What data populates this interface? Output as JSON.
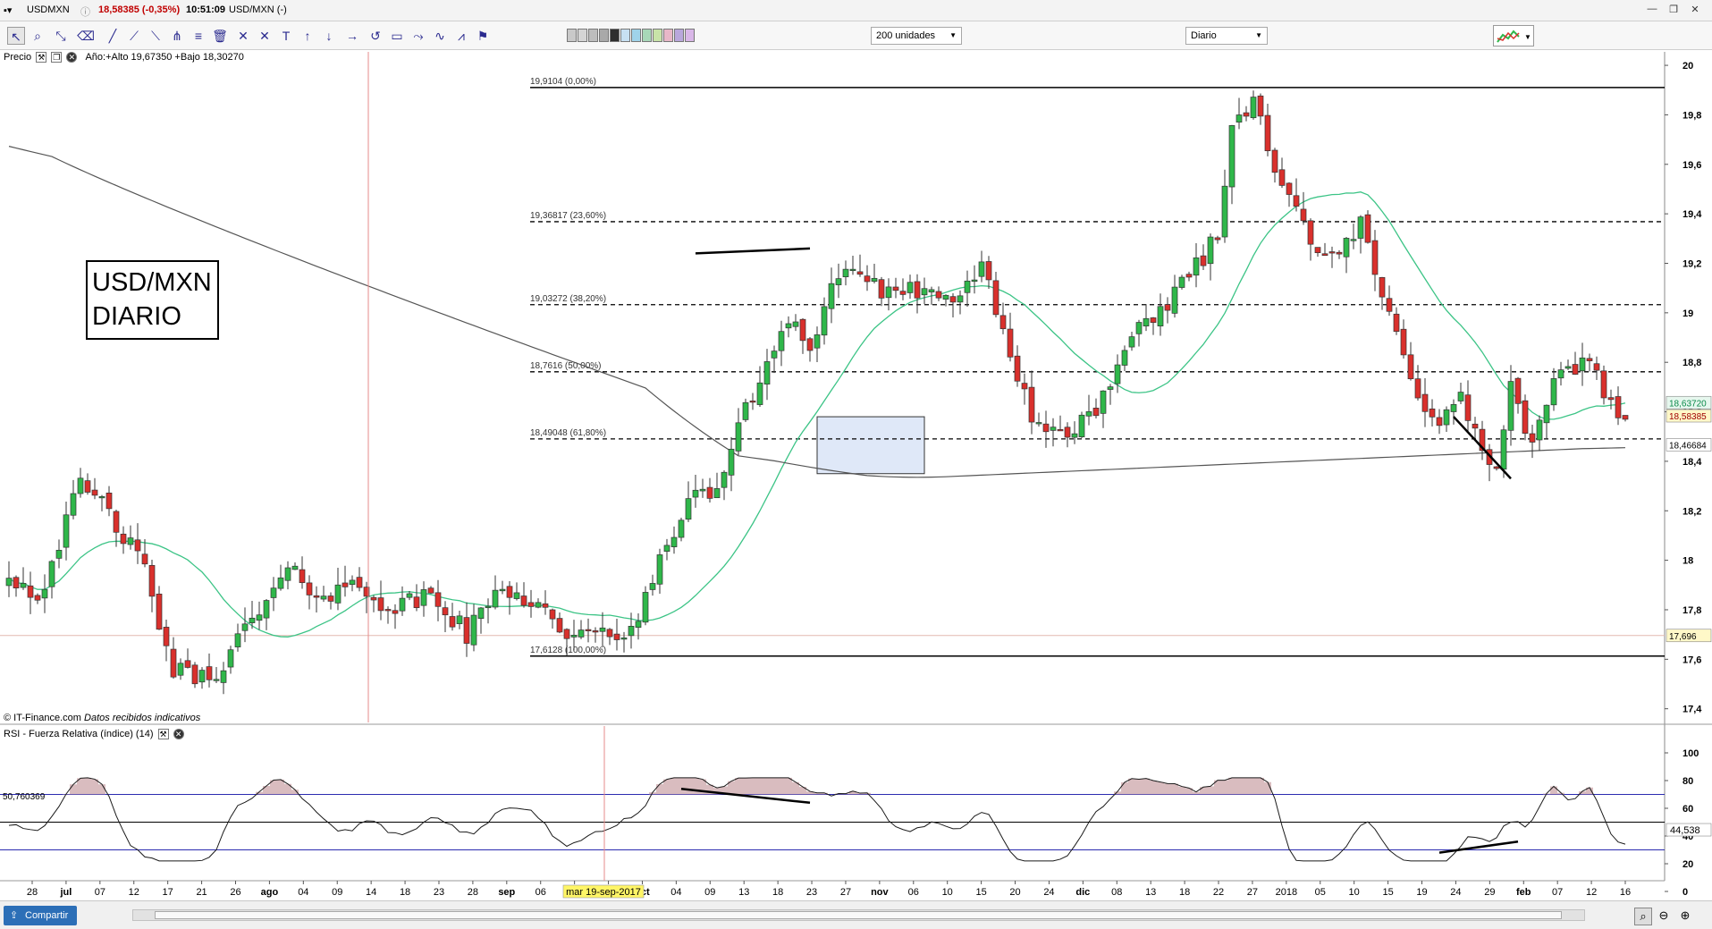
{
  "window": {
    "symbol": "USDMXN",
    "price": "18,58385 (-0,35%)",
    "time": "10:51:09",
    "title": "USD/MXN (-)",
    "minimize": "—",
    "restore": "❐",
    "close": "✕"
  },
  "toolbar": {
    "tools": [
      {
        "name": "pointer-icon",
        "glyph": "↖"
      },
      {
        "name": "zoom-icon",
        "glyph": "⌕"
      },
      {
        "name": "measure-icon",
        "glyph": "⤡"
      },
      {
        "name": "eraser-icon",
        "glyph": "⌫"
      },
      {
        "name": "line-icon",
        "glyph": "╱"
      },
      {
        "name": "ray-icon",
        "glyph": "⟋"
      },
      {
        "name": "trend-icon",
        "glyph": "⟍"
      },
      {
        "name": "fork-icon",
        "glyph": "⋔"
      },
      {
        "name": "levels-icon",
        "glyph": "≡"
      },
      {
        "name": "trash-icon",
        "glyph": "🗑"
      },
      {
        "name": "cross-icon",
        "glyph": "✕"
      },
      {
        "name": "multi-line-icon",
        "glyph": "✕"
      },
      {
        "name": "text-icon",
        "glyph": "T"
      },
      {
        "name": "arrow-up-icon",
        "glyph": "↑"
      },
      {
        "name": "arrow-down-icon",
        "glyph": "↓"
      },
      {
        "name": "arrow-right-icon",
        "glyph": "→"
      },
      {
        "name": "curve-icon",
        "glyph": "↺"
      },
      {
        "name": "rectangle-icon",
        "glyph": "▭"
      },
      {
        "name": "polyline-icon",
        "glyph": "⤳"
      },
      {
        "name": "zigzag-icon",
        "glyph": "∿"
      },
      {
        "name": "chart-type-icon",
        "glyph": "⩘"
      },
      {
        "name": "flag-icon",
        "glyph": "⚑"
      }
    ],
    "swatches": [
      "#c9c9c9",
      "#d5d5d5",
      "#bdbdbd",
      "#a9a9a9",
      "#2e2e2e",
      "#c7e0f2",
      "#9fd3ea",
      "#a8d7b8",
      "#c8e3a8",
      "#e8b7c8",
      "#b9a7dc",
      "#d9b7e8"
    ],
    "units_select": "200 unidades",
    "period_select": "Diario"
  },
  "price_panel": {
    "title": "Precio",
    "range_info": "Año:+Alto 19,67350 +Bajo 18,30270",
    "annotation": [
      "USD/MXN",
      "DIARIO"
    ],
    "footer": "© IT-Finance.com",
    "footer_italic": "Datos recibidos indicativos"
  },
  "rsi_panel": {
    "title": "RSI - Fuerza Relativa (índice) (14)",
    "left_value": "50,760369",
    "current_value": "44,538"
  },
  "cursor_label": "mar 19-sep-2017",
  "bottom": {
    "share_label": "Compartir"
  },
  "colors": {
    "up": "#2fb74a",
    "down": "#d9302c",
    "ma_green": "#3cc486",
    "ma_gray": "#555555",
    "rsi": "#1a1a1a",
    "box": "#dfe8f8"
  },
  "chart_data": {
    "type": "candlestick",
    "price_axis": {
      "ticks": [
        "20",
        "19,8",
        "19,6",
        "19,4",
        "19,2",
        "19",
        "18,8",
        "18,6",
        "18,4",
        "18,2",
        "18",
        "17,8",
        "17,6",
        "17,4"
      ],
      "ylim": [
        17.36,
        20.04
      ]
    },
    "rsi_axis": {
      "ticks": [
        "100",
        "80",
        "60",
        "40",
        "20",
        "0"
      ],
      "ylim": [
        0,
        100
      ],
      "bands": [
        70,
        50,
        30
      ]
    },
    "date_labels": [
      "28",
      "jul",
      "07",
      "12",
      "17",
      "21",
      "26",
      "ago",
      "04",
      "09",
      "14",
      "18",
      "23",
      "28",
      "sep",
      "06",
      "11",
      "15",
      "oct",
      "04",
      "09",
      "13",
      "18",
      "23",
      "27",
      "nov",
      "06",
      "10",
      "15",
      "20",
      "24",
      "dic",
      "08",
      "13",
      "18",
      "22",
      "27",
      "2018",
      "05",
      "10",
      "15",
      "19",
      "24",
      "29",
      "feb",
      "07",
      "12",
      "16"
    ],
    "axis_badges": [
      {
        "label": "18,63720",
        "value": 18.6372,
        "bg": "#e6f7ee",
        "fg": "#0a8a4a"
      },
      {
        "label": "18,58385",
        "value": 18.58385,
        "bg": "#fff8c8",
        "fg": "#a00000"
      },
      {
        "label": "18,46684",
        "value": 18.46684,
        "bg": "#ffffff",
        "fg": "#000000"
      },
      {
        "label": "17,696",
        "value": 17.696,
        "bg": "#fff8c8",
        "fg": "#000000"
      }
    ],
    "fibonacci": [
      {
        "label": "19,9104 (0,00%)",
        "value": 19.9104,
        "solid": true
      },
      {
        "label": "19,36817 (23,60%)",
        "value": 19.36817,
        "solid": false
      },
      {
        "label": "19,03272 (38,20%)",
        "value": 19.03272,
        "solid": false
      },
      {
        "label": "18,7616 (50,00%)",
        "value": 18.7616,
        "solid": false
      },
      {
        "label": "18,49048 (61,80%)",
        "value": 18.49048,
        "solid": false
      },
      {
        "label": "17,6128 (100,00%)",
        "value": 17.6128,
        "solid": true
      }
    ],
    "hline": 17.696,
    "anchors": [
      [
        0,
        17.95
      ],
      [
        4,
        17.85
      ],
      [
        10,
        18.3
      ],
      [
        14,
        18.2
      ],
      [
        19,
        17.95
      ],
      [
        23,
        17.55
      ],
      [
        28,
        17.52
      ],
      [
        34,
        17.75
      ],
      [
        39,
        17.95
      ],
      [
        44,
        17.86
      ],
      [
        49,
        17.9
      ],
      [
        54,
        17.8
      ],
      [
        59,
        17.86
      ],
      [
        64,
        17.7
      ],
      [
        69,
        17.9
      ],
      [
        74,
        17.82
      ],
      [
        79,
        17.68
      ],
      [
        84,
        17.7
      ],
      [
        88,
        17.74
      ],
      [
        91,
        18.0
      ],
      [
        94,
        18.2
      ],
      [
        99,
        18.3
      ],
      [
        103,
        18.6
      ],
      [
        106,
        18.8
      ],
      [
        109,
        19.0
      ],
      [
        112,
        18.85
      ],
      [
        115,
        19.1
      ],
      [
        118,
        19.2
      ],
      [
        121,
        19.1
      ],
      [
        124,
        19.05
      ],
      [
        128,
        19.12
      ],
      [
        132,
        19.0
      ],
      [
        136,
        19.2
      ],
      [
        139,
        18.95
      ],
      [
        141,
        18.7
      ],
      [
        144,
        18.55
      ],
      [
        148,
        18.5
      ],
      [
        151,
        18.6
      ],
      [
        154,
        18.68
      ],
      [
        157,
        18.9
      ],
      [
        160,
        18.95
      ],
      [
        163,
        19.1
      ],
      [
        166,
        19.2
      ],
      [
        169,
        19.3
      ],
      [
        171,
        19.75
      ],
      [
        174,
        19.88
      ],
      [
        177,
        19.6
      ],
      [
        180,
        19.45
      ],
      [
        183,
        19.2
      ],
      [
        186,
        19.25
      ],
      [
        189,
        19.35
      ],
      [
        192,
        19.05
      ],
      [
        195,
        18.85
      ],
      [
        197,
        18.68
      ],
      [
        200,
        18.55
      ],
      [
        203,
        18.65
      ],
      [
        206,
        18.45
      ],
      [
        208,
        18.35
      ],
      [
        210,
        18.7
      ],
      [
        213,
        18.45
      ],
      [
        215,
        18.6
      ],
      [
        217,
        18.8
      ],
      [
        219,
        18.75
      ],
      [
        221,
        18.85
      ],
      [
        224,
        18.62
      ],
      [
        226,
        18.58
      ]
    ],
    "trendlines": [
      {
        "x0": 96,
        "y0": 19.24,
        "x1": 112,
        "y1": 19.26
      },
      {
        "x0": 202,
        "y0": 18.58,
        "x1": 210,
        "y1": 18.33
      }
    ],
    "rsi_trendlines": [
      {
        "x0": 94,
        "y0": 74,
        "x1": 112,
        "y1": 64
      },
      {
        "x0": 200,
        "y0": 28,
        "x1": 211,
        "y1": 36
      }
    ],
    "box": {
      "x0": 113,
      "x1": 128,
      "y0": 18.35,
      "y1": 18.58
    },
    "cursor_index": 67
  }
}
